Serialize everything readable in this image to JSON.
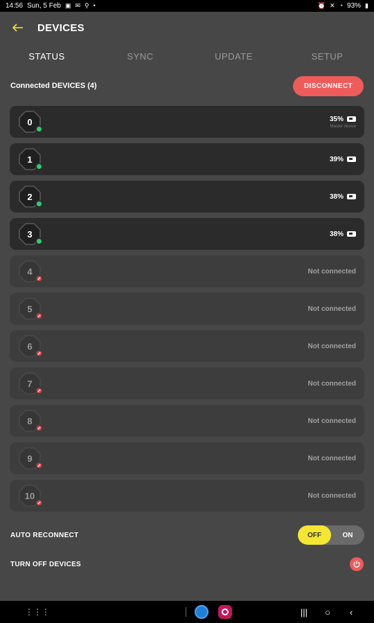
{
  "status_bar": {
    "time": "14:56",
    "date": "Sun, 5 Feb",
    "battery": "93%"
  },
  "header": {
    "title": "DEVICES"
  },
  "tabs": [
    {
      "label": "STATUS",
      "active": true
    },
    {
      "label": "SYNC",
      "active": false
    },
    {
      "label": "UPDATE",
      "active": false
    },
    {
      "label": "SETUP",
      "active": false
    }
  ],
  "connected": {
    "label": "Connected DEVICES (4)",
    "disconnect_label": "DISCONNECT"
  },
  "devices": [
    {
      "number": "0",
      "connected": true,
      "battery": "35%",
      "sub_label": "Master device"
    },
    {
      "number": "1",
      "connected": true,
      "battery": "39%"
    },
    {
      "number": "2",
      "connected": true,
      "battery": "38%"
    },
    {
      "number": "3",
      "connected": true,
      "battery": "38%"
    },
    {
      "number": "4",
      "connected": false,
      "status": "Not connected"
    },
    {
      "number": "5",
      "connected": false,
      "status": "Not connected"
    },
    {
      "number": "6",
      "connected": false,
      "status": "Not connected"
    },
    {
      "number": "7",
      "connected": false,
      "status": "Not connected"
    },
    {
      "number": "8",
      "connected": false,
      "status": "Not connected"
    },
    {
      "number": "9",
      "connected": false,
      "status": "Not connected"
    },
    {
      "number": "10",
      "connected": false,
      "status": "Not connected"
    }
  ],
  "settings": {
    "auto_reconnect_label": "AUTO RECONNECT",
    "toggle_off": "OFF",
    "toggle_on": "ON",
    "auto_reconnect_value": "OFF",
    "turn_off_label": "TURN OFF DEVICES"
  },
  "colors": {
    "accent_yellow": "#f5e632",
    "danger_red": "#ee5b5b",
    "ok_green": "#2ecc71",
    "background": "#474747"
  }
}
